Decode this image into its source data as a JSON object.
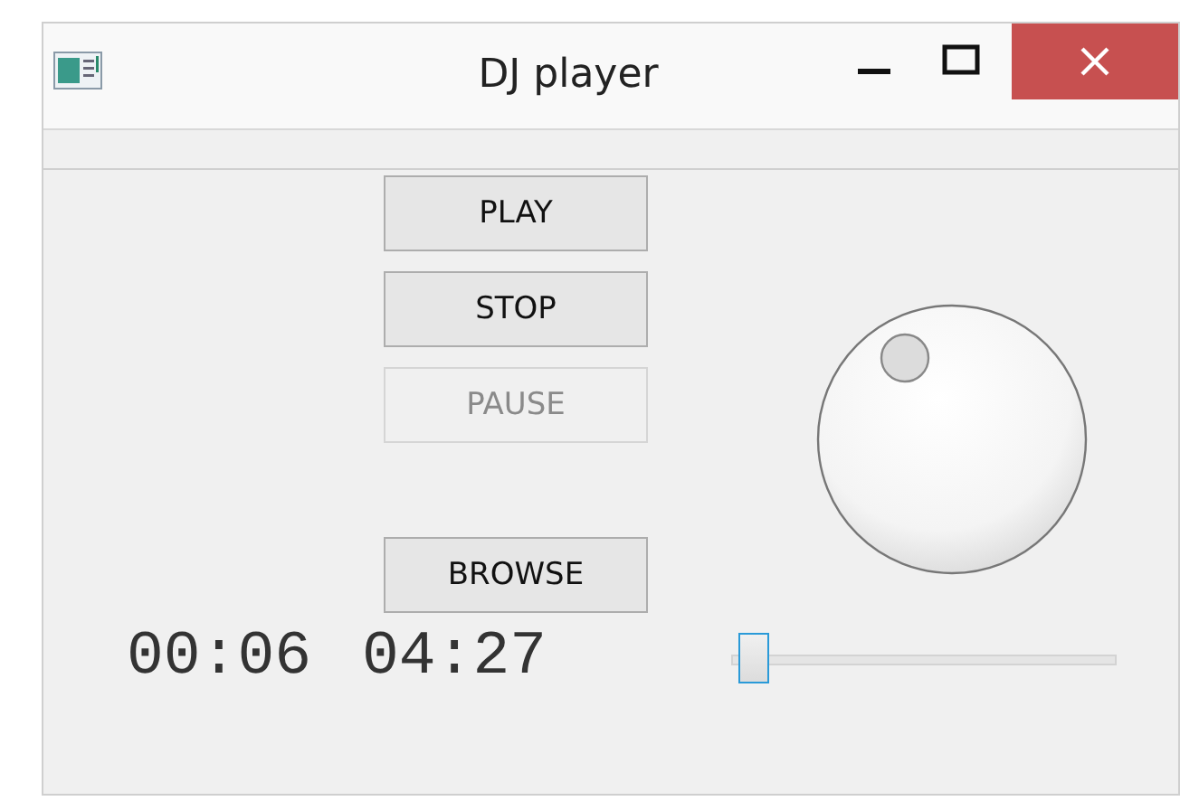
{
  "window": {
    "title": "DJ player"
  },
  "buttons": [
    {
      "label": "PLAY",
      "disabled": false
    },
    {
      "label": "STOP",
      "disabled": false
    },
    {
      "label": "PAUSE",
      "disabled": true
    },
    {
      "label": "BROWSE",
      "disabled": false
    }
  ],
  "elapsed": "00:06",
  "duration": "04:27",
  "slider": {
    "level": 0.0
  }
}
